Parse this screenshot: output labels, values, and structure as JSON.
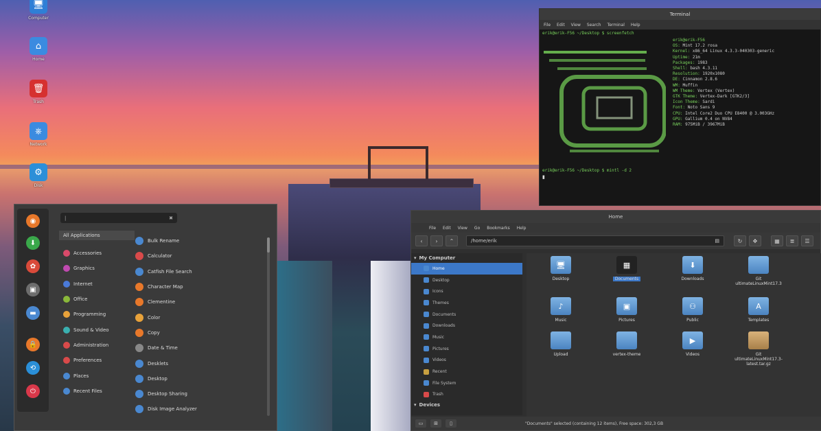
{
  "desktop": {
    "icons": [
      {
        "name": "computer-icon",
        "glyph": "🖥",
        "color": "#2f7fd6",
        "label": "Computer"
      },
      {
        "name": "home-icon",
        "glyph": "⌂",
        "color": "#3b8be0",
        "label": "Home"
      },
      {
        "name": "trash-icon",
        "glyph": "🗑",
        "color": "#d6312f",
        "label": "Trash"
      },
      {
        "name": "network-icon",
        "glyph": "⎈",
        "color": "#3b8be0",
        "label": "Network"
      },
      {
        "name": "disk-icon",
        "glyph": "⚙",
        "color": "#2c8fd8",
        "label": "Disk"
      }
    ]
  },
  "terminal": {
    "title": "Terminal",
    "menu": [
      "File",
      "Edit",
      "View",
      "Search",
      "Terminal",
      "Help"
    ],
    "prompt1": "erik@erik-F56 ~/Desktop $ screenfetch",
    "prompt2": "erik@erik-F56 ~/Desktop $ mintl -d 2",
    "cursor": "▮",
    "info": [
      {
        "k": "",
        "v": "erik@erik-F56"
      },
      {
        "k": "OS:",
        "v": "Mint 17.2 rosa"
      },
      {
        "k": "Kernel:",
        "v": "x86_64 Linux 4.3.3-040303-generic"
      },
      {
        "k": "Uptime:",
        "v": "21m"
      },
      {
        "k": "Packages:",
        "v": "1983"
      },
      {
        "k": "Shell:",
        "v": "bash 4.3.11"
      },
      {
        "k": "Resolution:",
        "v": "1920x1080"
      },
      {
        "k": "DE:",
        "v": "Cinnamon 2.8.6"
      },
      {
        "k": "WM:",
        "v": "Muffin"
      },
      {
        "k": "WM Theme:",
        "v": "Vertex (Vertex)"
      },
      {
        "k": "GTK Theme:",
        "v": "Vertex-Dark [GTK2/3]"
      },
      {
        "k": "Icon Theme:",
        "v": "Sardi"
      },
      {
        "k": "Font:",
        "v": "Noto Sans 9"
      },
      {
        "k": "CPU:",
        "v": "Intel Core2 Duo CPU E8400 @ 3.003GHz"
      },
      {
        "k": "GPU:",
        "v": "Gallium 0.4 on NV84"
      },
      {
        "k": "RAM:",
        "v": "975MiB / 3967MiB"
      }
    ]
  },
  "menu": {
    "search_text": "|",
    "search_icon": "✖",
    "favorites": [
      {
        "name": "firefox-icon",
        "glyph": "◉",
        "color": "#e8782a"
      },
      {
        "name": "software-icon",
        "glyph": "⬇",
        "color": "#3aa84a"
      },
      {
        "name": "settings-icon",
        "glyph": "✿",
        "color": "#d94a3a"
      },
      {
        "name": "terminal-icon",
        "glyph": "▣",
        "color": "#6d6d6d"
      },
      {
        "name": "files-icon",
        "glyph": "▬",
        "color": "#4a88d0"
      },
      {
        "name": "lock-icon",
        "glyph": "🔒",
        "color": "#e8782a"
      },
      {
        "name": "logout-icon",
        "glyph": "⟲",
        "color": "#2a8fd8"
      },
      {
        "name": "power-icon",
        "glyph": "⏻",
        "color": "#d9384a"
      }
    ],
    "categories": [
      {
        "label": "All Applications",
        "color": ""
      },
      {
        "label": "Accessories",
        "color": "#d94a6a"
      },
      {
        "label": "Graphics",
        "color": "#c04ab0"
      },
      {
        "label": "Internet",
        "color": "#4a7ad8"
      },
      {
        "label": "Office",
        "color": "#8ab83a"
      },
      {
        "label": "Programming",
        "color": "#e8a23a"
      },
      {
        "label": "Sound & Video",
        "color": "#3ab0b0"
      },
      {
        "label": "Administration",
        "color": "#d94a4a"
      },
      {
        "label": "Preferences",
        "color": "#d94a4a"
      },
      {
        "label": "Places",
        "color": "#4a88d0"
      },
      {
        "label": "Recent Files",
        "color": "#4a88d0"
      }
    ],
    "apps": [
      {
        "label": "Bulk Rename",
        "color": "#4a88d0"
      },
      {
        "label": "Calculator",
        "color": "#d94a4a"
      },
      {
        "label": "Catfish File Search",
        "color": "#4a88d0"
      },
      {
        "label": "Character Map",
        "color": "#e8782a"
      },
      {
        "label": "Clementine",
        "color": "#e8782a"
      },
      {
        "label": "Color",
        "color": "#e8a23a"
      },
      {
        "label": "Copy",
        "color": "#e8782a"
      },
      {
        "label": "Date & Time",
        "color": "#888888"
      },
      {
        "label": "Desklets",
        "color": "#4a88d0"
      },
      {
        "label": "Desktop",
        "color": "#4a88d0"
      },
      {
        "label": "Desktop Sharing",
        "color": "#4a88d0"
      },
      {
        "label": "Disk Image Analyzer",
        "color": "#4a88d0"
      }
    ]
  },
  "filemanager": {
    "title": "Home",
    "menu": [
      "File",
      "Edit",
      "View",
      "Go",
      "Bookmarks",
      "Help"
    ],
    "location": "/home/erik",
    "sidebar_header": "My Computer",
    "sidebar_items": [
      "Home",
      "Desktop",
      "Icons",
      "Themes",
      "Documents",
      "Downloads",
      "Music",
      "Pictures",
      "Videos",
      "Recent",
      "File System",
      "Trash"
    ],
    "sidebar_footer": "Devices",
    "files": [
      {
        "label": "Desktop",
        "glyph": "🖥"
      },
      {
        "label": "Documents",
        "glyph": "▦"
      },
      {
        "label": "Downloads",
        "glyph": "⬇"
      },
      {
        "label": "Git ultimateLinuxMint17.3",
        "glyph": ""
      },
      {
        "label": "Music",
        "glyph": "♪"
      },
      {
        "label": "Pictures",
        "glyph": "▣"
      },
      {
        "label": "Public",
        "glyph": "⚇"
      },
      {
        "label": "Templates",
        "glyph": "A"
      },
      {
        "label": "Upload",
        "glyph": ""
      },
      {
        "label": "vertex-theme",
        "glyph": ""
      },
      {
        "label": "Videos",
        "glyph": "▶"
      },
      {
        "label": "Git ultimateLinuxMint17.3-latest.tar.gz",
        "glyph": ""
      }
    ],
    "selected_file": "Documents",
    "status": "\"Documents\" selected (containing 12 items), Free space: 302,3 GB"
  }
}
